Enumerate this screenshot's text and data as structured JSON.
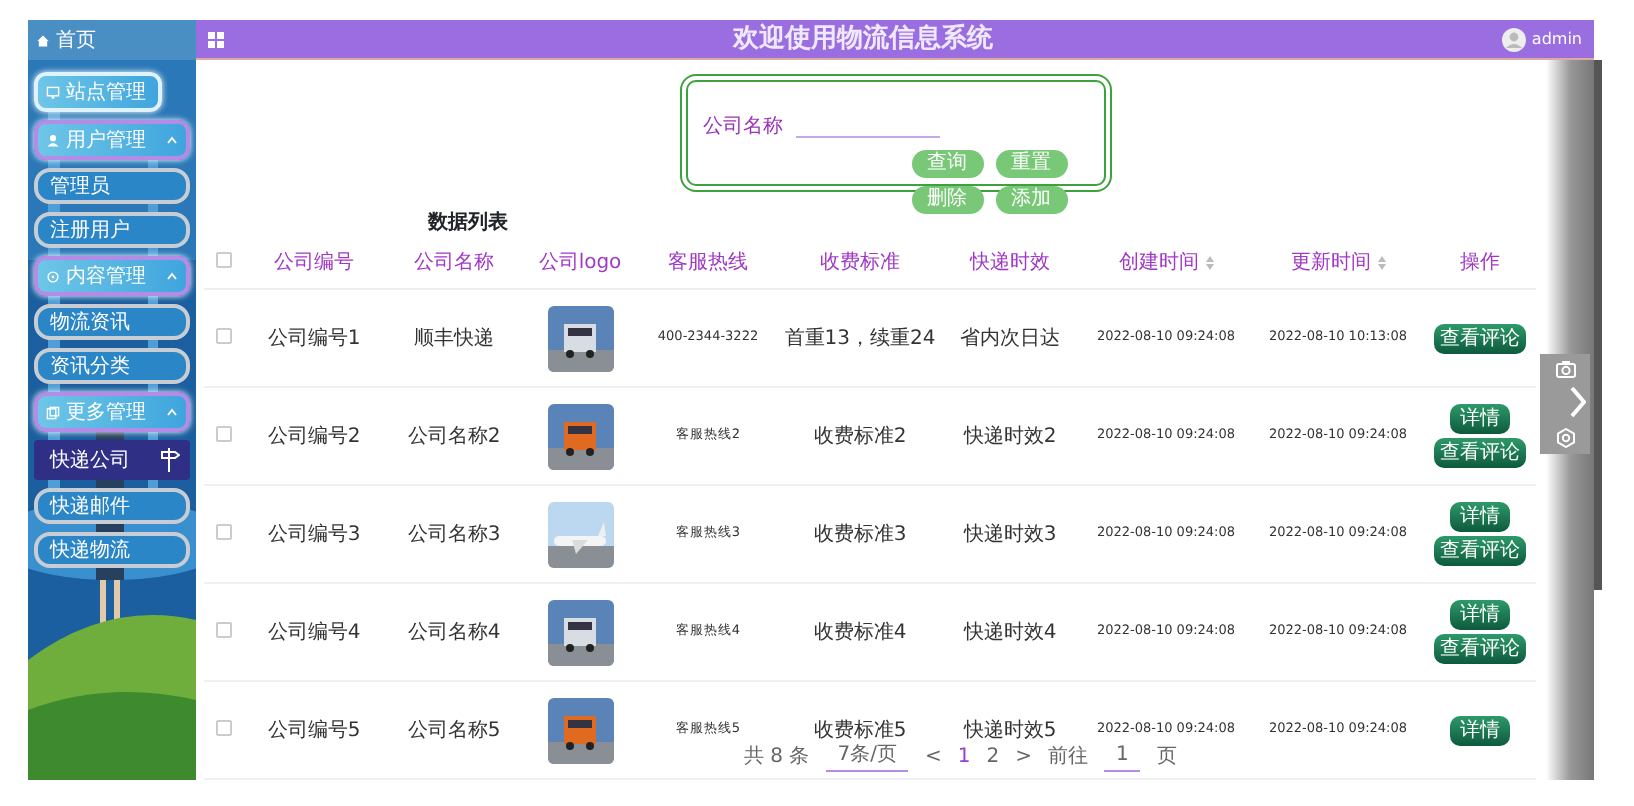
{
  "sidebar": {
    "home": "首页",
    "items": [
      {
        "label": "站点管理",
        "kind": "single"
      },
      {
        "label": "用户管理",
        "kind": "group",
        "expanded": true,
        "children": [
          {
            "label": "管理员",
            "selected": false
          },
          {
            "label": "注册用户",
            "selected": false
          }
        ]
      },
      {
        "label": "内容管理",
        "kind": "group",
        "expanded": true,
        "children": [
          {
            "label": "物流资讯",
            "selected": false
          },
          {
            "label": "资讯分类",
            "selected": false
          }
        ]
      },
      {
        "label": "更多管理",
        "kind": "group",
        "expanded": true,
        "children": [
          {
            "label": "快递公司",
            "selected": true
          },
          {
            "label": "快递邮件",
            "selected": false
          },
          {
            "label": "快递物流",
            "selected": false
          }
        ]
      }
    ]
  },
  "header": {
    "title": "欢迎使用物流信息系统",
    "user": "admin"
  },
  "search": {
    "label": "公司名称",
    "buttons": [
      "查询",
      "重置",
      "删除",
      "添加"
    ]
  },
  "table": {
    "caption": "数据列表",
    "all_checked": false,
    "columns": [
      {
        "label": "公司编号",
        "sortable": false
      },
      {
        "label": "公司名称",
        "sortable": false
      },
      {
        "label": "公司logo",
        "sortable": false
      },
      {
        "label": "客服热线",
        "sortable": false
      },
      {
        "label": "收费标准",
        "sortable": false
      },
      {
        "label": "快递时效",
        "sortable": false
      },
      {
        "label": "创建时间",
        "sortable": true
      },
      {
        "label": "更新时间",
        "sortable": true
      },
      {
        "label": "操作",
        "sortable": false
      }
    ],
    "rows": [
      {
        "checked": false,
        "cells": [
          "公司编号1",
          "顺丰快递",
          {
            "kind": "picture"
          },
          "400-2344-3222",
          "首重13，续重24",
          "省内次日达",
          "2022-08-10 09:24:08",
          "2022-08-10 10:13:08"
        ],
        "actions": [
          "查看评论"
        ]
      },
      {
        "checked": false,
        "cells": [
          "公司编号2",
          "公司名称2",
          {
            "kind": "picture"
          },
          "客服热线2",
          "收费标准2",
          "快递时效2",
          "2022-08-10 09:24:08",
          "2022-08-10 09:24:08"
        ],
        "actions": [
          "详情",
          "查看评论"
        ]
      },
      {
        "checked": false,
        "cells": [
          "公司编号3",
          "公司名称3",
          {
            "kind": "picture"
          },
          "客服热线3",
          "收费标准3",
          "快递时效3",
          "2022-08-10 09:24:08",
          "2022-08-10 09:24:08"
        ],
        "actions": [
          "详情",
          "查看评论"
        ]
      },
      {
        "checked": false,
        "cells": [
          "公司编号4",
          "公司名称4",
          {
            "kind": "picture"
          },
          "客服热线4",
          "收费标准4",
          "快递时效4",
          "2022-08-10 09:24:08",
          "2022-08-10 09:24:08"
        ],
        "actions": [
          "详情",
          "查看评论"
        ]
      },
      {
        "checked": false,
        "cells": [
          "公司编号5",
          "公司名称5",
          {
            "kind": "picture"
          },
          "客服热线5",
          "收费标准5",
          "快递时效5",
          "2022-08-10 09:24:08",
          "2022-08-10 09:24:08"
        ],
        "actions": [
          "详情"
        ]
      }
    ]
  },
  "pagination": {
    "total": "共 8 条",
    "page_size": "7条/页",
    "prev": "<",
    "pages": [
      {
        "label": "1",
        "selected": true
      },
      {
        "label": "2",
        "selected": false
      }
    ],
    "next": ">",
    "goto_label": "前往",
    "goto_value": "1",
    "goto_suffix": "页"
  }
}
